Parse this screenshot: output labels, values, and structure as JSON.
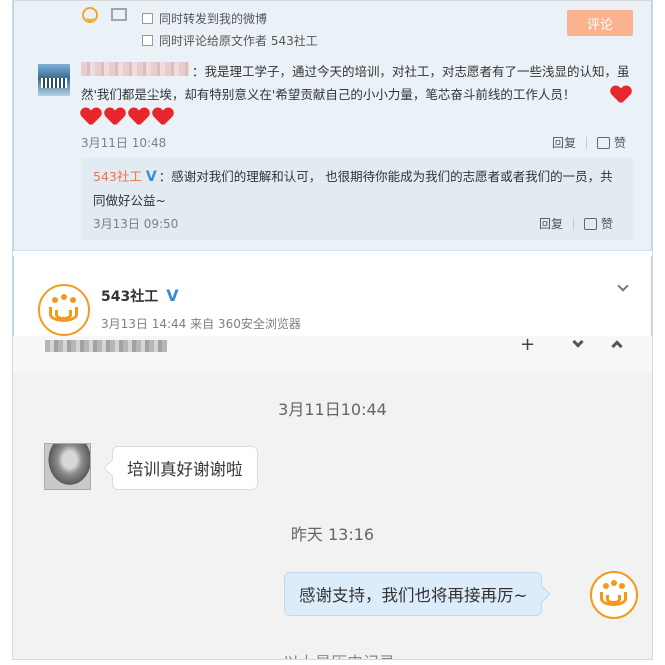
{
  "weibo": {
    "opt_forward": "同时转发到我的微博",
    "opt_comment_to": "同时评论给原文作者 543社工",
    "comment_button": "评论",
    "comment": {
      "text": "：我是理工学子，通过今天的培训，对社工，对志愿者有了一些浅显的认知，虽然'我们都是尘埃，却有特别意义在'希望贡献自己的小小力量，笔芯奋斗前线的工作人员！",
      "hearts": 5,
      "time": "3月11日 10:48",
      "reply_label": "回复",
      "like_label": "赞"
    },
    "reply": {
      "author": "543社工",
      "verified_mark": "V",
      "text": "：感谢对我们的理解和认可， 也很期待你能成为我们的志愿者或者我们的一员，共同做好公益~",
      "time": "3月13日 09:50",
      "reply_label": "回复",
      "like_label": "赞"
    }
  },
  "post": {
    "author": "543社工",
    "verified_mark": "V",
    "meta": "3月13日 14:44 来自 360安全浏览器"
  },
  "chat": {
    "top_icons": {
      "left": "⁺",
      "mid": "⌄",
      "right": "⌃"
    },
    "messages": [
      {
        "timestamp": "3月11日10:44",
        "direction": "in",
        "text": "培训真好谢谢啦"
      },
      {
        "timestamp": "昨天 13:16",
        "direction": "out",
        "text": "感谢支持，我们也将再接再厉~"
      }
    ],
    "cutoff_text": "以上是历史记录"
  },
  "colors": {
    "accent_orange": "#f39a1e",
    "name_orange": "#eb7350",
    "verified_blue": "#3a8ad6",
    "comment_btn": "#fbb28f"
  }
}
